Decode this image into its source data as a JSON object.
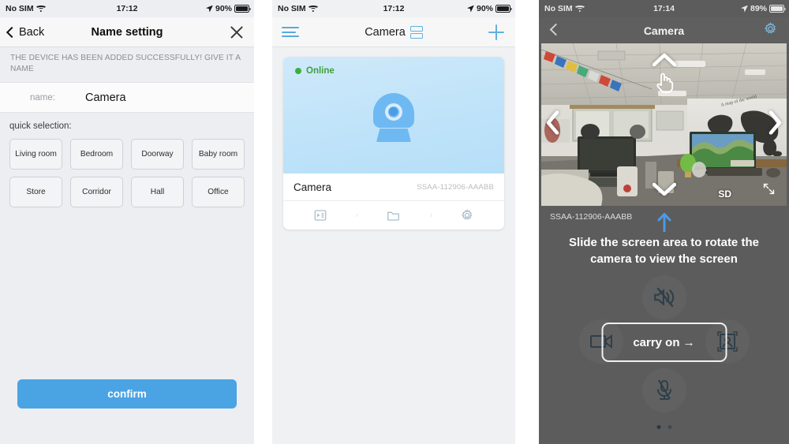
{
  "screen1": {
    "status": {
      "carrier": "No SIM",
      "time": "17:12",
      "battery": "90%",
      "wifi_icon": "wifi-icon",
      "location_icon": "location-arrow-icon",
      "battery_icon": "battery-icon"
    },
    "nav": {
      "back_label": "Back",
      "title": "Name setting",
      "close_icon": "close-x-icon",
      "back_icon": "chevron-left-icon"
    },
    "hint": "THE DEVICE HAS BEEN ADDED SUCCESSFULLY! GIVE IT A NAME",
    "name_row": {
      "label": "name:",
      "value": "Camera"
    },
    "quick_selection": {
      "title": "quick selection:",
      "options": [
        "Living room",
        "Bedroom",
        "Doorway",
        "Baby room",
        "Store",
        "Corridor",
        "Hall",
        "Office"
      ]
    },
    "confirm_label": "confirm",
    "accent_color": "#4aa3e3"
  },
  "screen2": {
    "status": {
      "carrier": "No SIM",
      "time": "17:12",
      "battery": "90%"
    },
    "nav": {
      "menu_icon": "hamburger-menu-icon",
      "title": "Camera",
      "view_toggle_icon": "list-view-toggle-icon",
      "add_icon": "plus-add-icon"
    },
    "device_card": {
      "status_text": "Online",
      "status_color": "#3bb03b",
      "thumbnail_icon": "camera-device-icon",
      "name": "Camera",
      "serial": "SSAA-112906-AAABB",
      "tools": [
        {
          "name": "playback-icon",
          "label": "playback"
        },
        {
          "name": "folder-icon",
          "label": "files"
        },
        {
          "name": "gear-icon",
          "label": "settings"
        }
      ]
    }
  },
  "screen3": {
    "status": {
      "carrier": "No SIM",
      "time": "17:14",
      "battery": "89%"
    },
    "nav": {
      "back_icon": "chevron-left-icon",
      "title": "Camera",
      "settings_icon": "gear-icon"
    },
    "video": {
      "quality_label": "SD",
      "expand_icon": "fullscreen-expand-icon",
      "pan_up_icon": "chevron-up-icon",
      "pan_down_icon": "chevron-down-icon",
      "pan_left_icon": "chevron-left-icon",
      "pan_right_icon": "chevron-right-icon",
      "hand_cursor_icon": "hand-pointer-icon"
    },
    "serial": "SSAA-112906-AAABB",
    "tutorial": {
      "arrow_icon": "up-arrow-icon",
      "arrow_color": "#4a9ae8",
      "text": "Slide the screen area to rotate the camera to view the screen",
      "button_label": "carry on →"
    },
    "controls": [
      {
        "name": "speaker-mute-icon",
        "label": "speaker"
      },
      {
        "name": "video-record-icon",
        "label": "record"
      },
      {
        "name": "snapshot-icon",
        "label": "snapshot"
      },
      {
        "name": "microphone-mute-icon",
        "label": "microphone"
      }
    ],
    "page_dots": 2
  }
}
